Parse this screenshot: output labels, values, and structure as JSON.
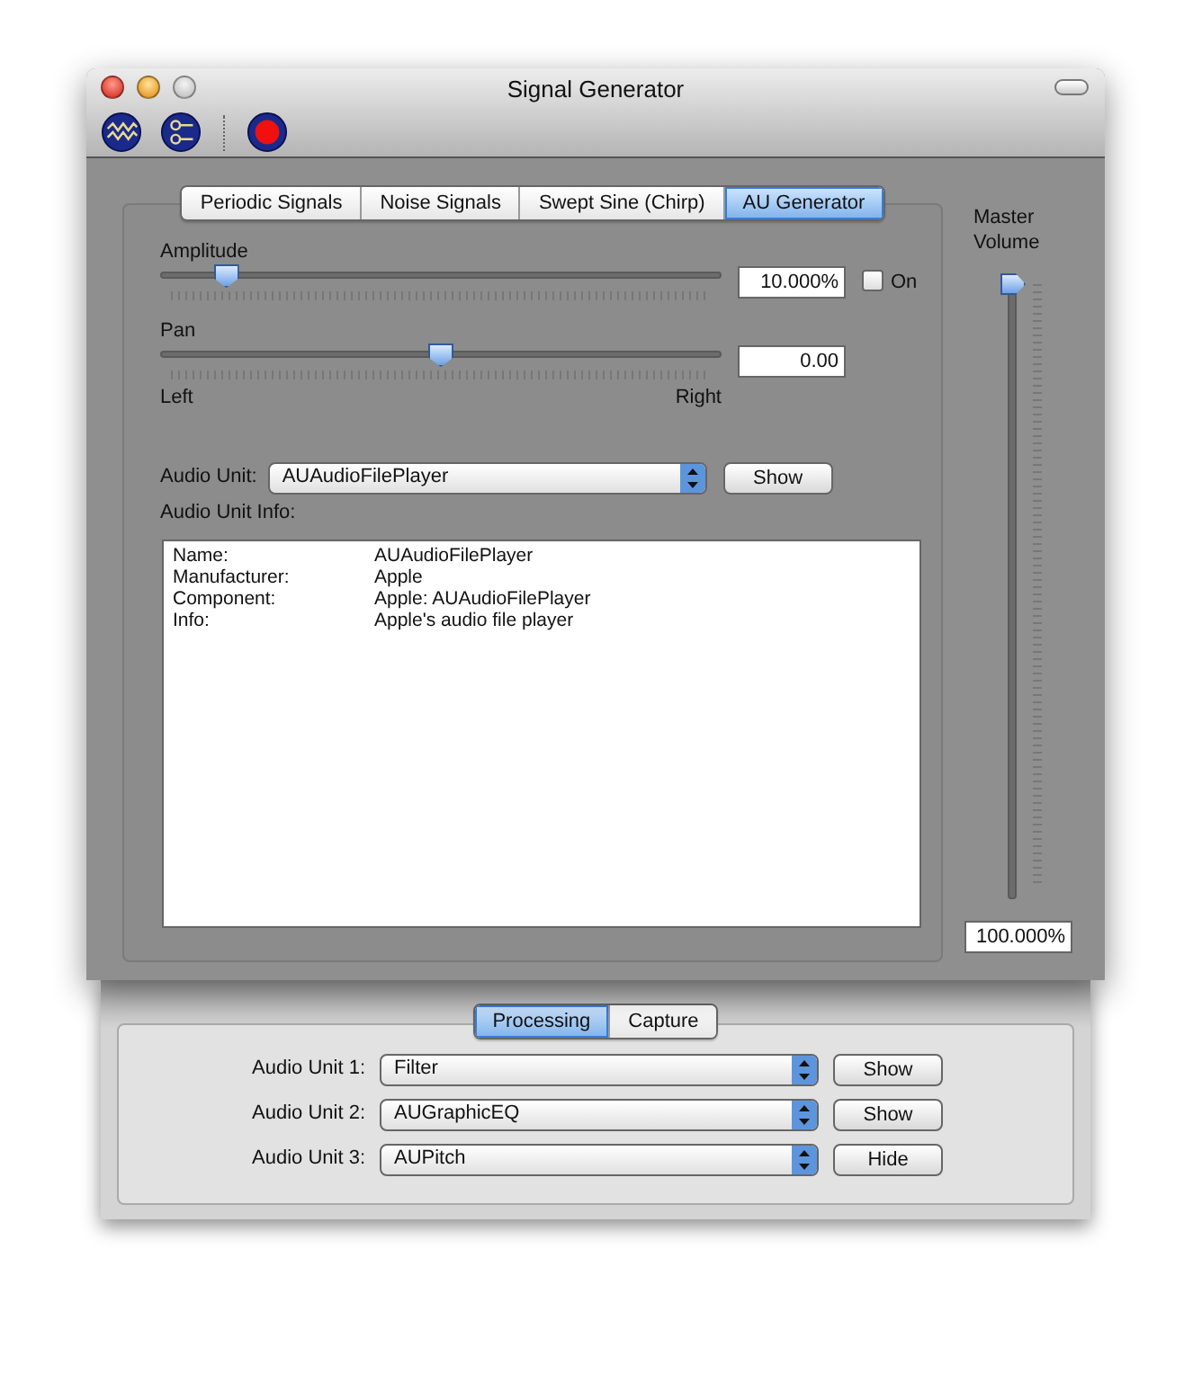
{
  "window": {
    "title": "Signal Generator"
  },
  "tabs": [
    {
      "label": "Periodic Signals",
      "selected": false
    },
    {
      "label": "Noise Signals",
      "selected": false
    },
    {
      "label": "Swept Sine (Chirp)",
      "selected": false
    },
    {
      "label": "AU Generator",
      "selected": true
    }
  ],
  "amplitude": {
    "label": "Amplitude",
    "level": 0.1,
    "value": "10.000%",
    "toggle": {
      "label": "On",
      "checked": false
    }
  },
  "pan": {
    "label": "Pan",
    "level": 0.5,
    "value": "0.00",
    "left": "Left",
    "right": "Right"
  },
  "audio_unit": {
    "label": "Audio Unit:",
    "value": "AUAudioFilePlayer",
    "button": "Show"
  },
  "info": {
    "label": "Audio Unit Info:",
    "rows": [
      {
        "key": "Name:",
        "value": "AUAudioFilePlayer"
      },
      {
        "key": "Manufacturer:",
        "value": "Apple"
      },
      {
        "key": "Component:",
        "value": "Apple: AUAudioFilePlayer"
      },
      {
        "key": "Info:",
        "value": "Apple's audio file player"
      }
    ]
  },
  "master_volume": {
    "label": "Master Volume",
    "level": 1,
    "value": "100.000%"
  },
  "drawer": {
    "tabs": [
      {
        "label": "Processing",
        "selected": true
      },
      {
        "label": "Capture",
        "selected": false
      }
    ],
    "units": [
      {
        "label": "Audio Unit 1:",
        "value": "Filter",
        "button": "Show"
      },
      {
        "label": "Audio Unit 2:",
        "value": "AUGraphicEQ",
        "button": "Show"
      },
      {
        "label": "Audio Unit 3:",
        "value": "AUPitch",
        "button": "Hide"
      }
    ]
  }
}
